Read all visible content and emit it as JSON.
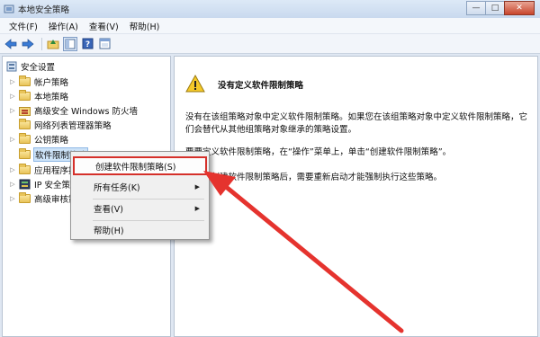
{
  "window": {
    "title": "本地安全策略"
  },
  "window_buttons": {
    "minimize": "—",
    "maximize": "□",
    "close": "✕"
  },
  "menubar": [
    {
      "name": "menu-file",
      "label": "文件(F)"
    },
    {
      "name": "menu-action",
      "label": "操作(A)"
    },
    {
      "name": "menu-view",
      "label": "查看(V)"
    },
    {
      "name": "menu-help",
      "label": "帮助(H)"
    }
  ],
  "toolbar": {
    "buttons": [
      "back-arrow-icon",
      "forward-arrow-icon",
      "up-folder-icon",
      "show-tree-icon",
      "help-icon",
      "console-icon"
    ]
  },
  "tree": {
    "root": "安全设置",
    "items": [
      {
        "label": "帐户策略",
        "icon": "folder-icon"
      },
      {
        "label": "本地策略",
        "icon": "folder-icon"
      },
      {
        "label": "高级安全 Windows 防火墙",
        "icon": "firewall-folder-icon"
      },
      {
        "label": "网络列表管理器策略",
        "icon": "folder-icon"
      },
      {
        "label": "公钥策略",
        "icon": "folder-icon"
      },
      {
        "label": "软件限制策略",
        "icon": "folder-icon"
      },
      {
        "label": "应用程序控",
        "icon": "folder-icon"
      },
      {
        "label": "IP 安全策略",
        "icon": "ip-security-icon"
      },
      {
        "label": "高级审核策",
        "icon": "folder-icon"
      }
    ]
  },
  "content": {
    "heading": "没有定义软件限制策略",
    "para1_line1": "没有在该组策略对象中定义软件限制策略。如果您在该组策略对象中定义软件限制策略，它",
    "para1_line2": "们会替代从其他组策略对象继承的策略设置。",
    "para2": "要要定义软件限制策略，在“操作”菜单上，单击“创建软件限制策略”。",
    "para3": "在最初创建软件限制策略后，需要重新启动才能强制执行这些策略。"
  },
  "context_menu": {
    "items": [
      {
        "label": "创建软件限制策略(S)",
        "submenu": ""
      },
      {
        "label": "所有任务(K)",
        "submenu": "▶"
      },
      {
        "label": "查看(V)",
        "submenu": "▶"
      },
      {
        "label": "帮助(H)",
        "submenu": ""
      }
    ]
  },
  "colors": {
    "annotation_red": "#e5332e",
    "highlight_border": "#d5302a"
  }
}
